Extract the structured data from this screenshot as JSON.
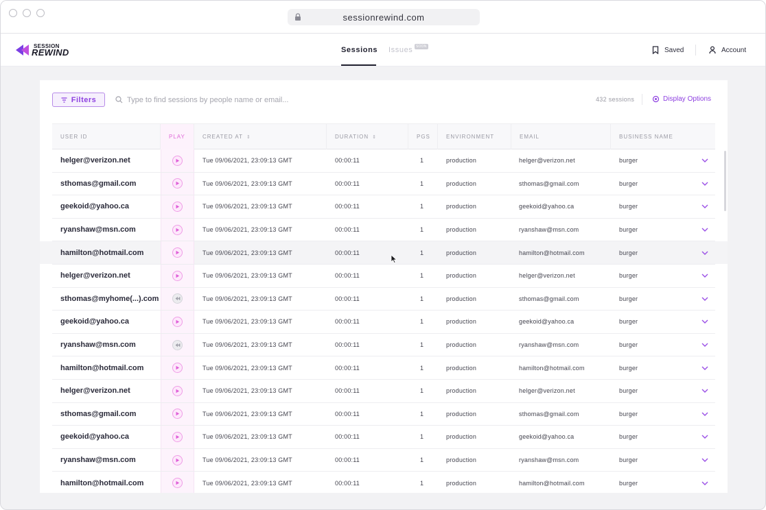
{
  "browser": {
    "url": "sessionrewind.com"
  },
  "brand": {
    "line1": "SESSION",
    "line2": "REWIND",
    "accent": "#7b3fe4"
  },
  "nav": {
    "tabs": [
      {
        "label": "Sessions",
        "active": true
      },
      {
        "label": "Issues",
        "active": false,
        "badge": "SOON"
      }
    ],
    "saved_label": "Saved",
    "account_label": "Account"
  },
  "toolbar": {
    "filters_label": "Filters",
    "search_placeholder": "Type to find sessions by people name or email...",
    "session_count": "432 sessions",
    "display_options_label": "Display Options"
  },
  "table": {
    "columns": [
      {
        "label": "USER ID",
        "sortable": false
      },
      {
        "label": "PLAY",
        "sortable": false
      },
      {
        "label": "CREATED AT",
        "sortable": true
      },
      {
        "label": "DURATION",
        "sortable": true
      },
      {
        "label": "PGS",
        "sortable": false
      },
      {
        "label": "ENVIRONMENT",
        "sortable": false
      },
      {
        "label": "EMAIL",
        "sortable": false
      },
      {
        "label": "BUSINESS NAME",
        "sortable": false
      }
    ],
    "rows": [
      {
        "user_id": "helger@verizon.net",
        "play": "play",
        "created_at": "Tue 09/06/2021, 23:09:13 GMT",
        "duration": "00:00:11",
        "pgs": "1",
        "environment": "production",
        "email": "helger@verizon.net",
        "business": "burger"
      },
      {
        "user_id": "sthomas@gmail.com",
        "play": "play",
        "created_at": "Tue 09/06/2021, 23:09:13 GMT",
        "duration": "00:00:11",
        "pgs": "1",
        "environment": "production",
        "email": "sthomas@gmail.com",
        "business": "burger"
      },
      {
        "user_id": "geekoid@yahoo.ca",
        "play": "play",
        "created_at": "Tue 09/06/2021, 23:09:13 GMT",
        "duration": "00:00:11",
        "pgs": "1",
        "environment": "production",
        "email": "geekoid@yahoo.ca",
        "business": "burger"
      },
      {
        "user_id": "ryanshaw@msn.com",
        "play": "play",
        "created_at": "Tue 09/06/2021, 23:09:13 GMT",
        "duration": "00:00:11",
        "pgs": "1",
        "environment": "production",
        "email": "ryanshaw@msn.com",
        "business": "burger"
      },
      {
        "user_id": "hamilton@hotmail.com",
        "play": "play",
        "created_at": "Tue 09/06/2021, 23:09:13 GMT",
        "duration": "00:00:11",
        "pgs": "1",
        "environment": "production",
        "email": "hamilton@hotmail.com",
        "business": "burger",
        "hovered": true
      },
      {
        "user_id": "helger@verizon.net",
        "play": "play",
        "created_at": "Tue 09/06/2021, 23:09:13 GMT",
        "duration": "00:00:11",
        "pgs": "1",
        "environment": "production",
        "email": "helger@verizon.net",
        "business": "burger"
      },
      {
        "user_id": "sthomas@myhome(...).com",
        "play": "rewind",
        "created_at": "Tue 09/06/2021, 23:09:13 GMT",
        "duration": "00:00:11",
        "pgs": "1",
        "environment": "production",
        "email": "sthomas@gmail.com",
        "business": "burger"
      },
      {
        "user_id": "geekoid@yahoo.ca",
        "play": "play",
        "created_at": "Tue 09/06/2021, 23:09:13 GMT",
        "duration": "00:00:11",
        "pgs": "1",
        "environment": "production",
        "email": "geekoid@yahoo.ca",
        "business": "burger"
      },
      {
        "user_id": "ryanshaw@msn.com",
        "play": "rewind",
        "created_at": "Tue 09/06/2021, 23:09:13 GMT",
        "duration": "00:00:11",
        "pgs": "1",
        "environment": "production",
        "email": "ryanshaw@msn.com",
        "business": "burger"
      },
      {
        "user_id": "hamilton@hotmail.com",
        "play": "play",
        "created_at": "Tue 09/06/2021, 23:09:13 GMT",
        "duration": "00:00:11",
        "pgs": "1",
        "environment": "production",
        "email": "hamilton@hotmail.com",
        "business": "burger"
      },
      {
        "user_id": "helger@verizon.net",
        "play": "play",
        "created_at": "Tue 09/06/2021, 23:09:13 GMT",
        "duration": "00:00:11",
        "pgs": "1",
        "environment": "production",
        "email": "helger@verizon.net",
        "business": "burger"
      },
      {
        "user_id": "sthomas@gmail.com",
        "play": "play",
        "created_at": "Tue 09/06/2021, 23:09:13 GMT",
        "duration": "00:00:11",
        "pgs": "1",
        "environment": "production",
        "email": "sthomas@gmail.com",
        "business": "burger"
      },
      {
        "user_id": "geekoid@yahoo.ca",
        "play": "play",
        "created_at": "Tue 09/06/2021, 23:09:13 GMT",
        "duration": "00:00:11",
        "pgs": "1",
        "environment": "production",
        "email": "geekoid@yahoo.ca",
        "business": "burger"
      },
      {
        "user_id": "ryanshaw@msn.com",
        "play": "play",
        "created_at": "Tue 09/06/2021, 23:09:13 GMT",
        "duration": "00:00:11",
        "pgs": "1",
        "environment": "production",
        "email": "ryanshaw@msn.com",
        "business": "burger"
      },
      {
        "user_id": "hamilton@hotmail.com",
        "play": "play",
        "created_at": "Tue 09/06/2021, 23:09:13 GMT",
        "duration": "00:00:11",
        "pgs": "1",
        "environment": "production",
        "email": "hamilton@hotmail.com",
        "business": "burger"
      }
    ]
  },
  "icons": {
    "lock": "lock-icon",
    "bookmark": "bookmark-icon",
    "user": "user-icon",
    "filter": "filter-icon",
    "search": "search-icon",
    "display": "settings-icon",
    "play": "play-icon",
    "rewind": "rewind-icon",
    "chevron": "chevron-down-icon"
  }
}
